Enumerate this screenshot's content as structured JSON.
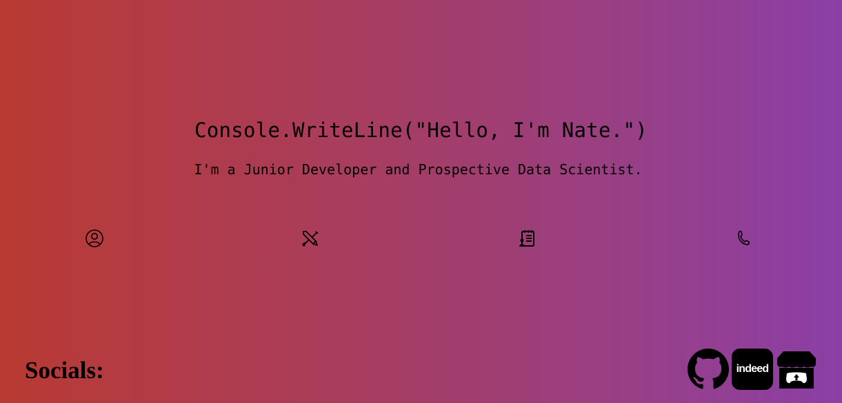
{
  "hero": {
    "title": "Console.WriteLine(\"Hello, I'm Nate.\")",
    "subtitle": "I'm a Junior Developer and Prospective Data Scientist."
  },
  "nav_icons": [
    "profile-icon",
    "tools-icon",
    "resume-icon",
    "phone-icon"
  ],
  "socials": {
    "label": "Socials:",
    "links": [
      {
        "name": "GitHub",
        "icon": "github-icon"
      },
      {
        "name": "Indeed",
        "icon": "indeed-icon",
        "logo_text": "indeed"
      },
      {
        "name": "itch.io",
        "icon": "itchio-icon"
      }
    ]
  },
  "colors": {
    "gradient_start": "#b93a32",
    "gradient_end": "#8b3fa6"
  }
}
